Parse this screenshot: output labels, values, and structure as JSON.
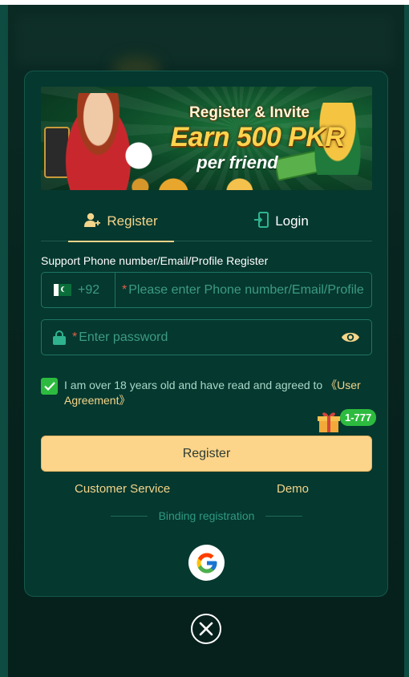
{
  "banner": {
    "line1": "Register & Invite",
    "line2": "Earn 500 PKR",
    "line3": "per friend"
  },
  "tabs": [
    {
      "label": "Register",
      "icon": "user-add-icon",
      "active": true
    },
    {
      "label": "Login",
      "icon": "login-icon",
      "active": false
    }
  ],
  "form": {
    "support_label": "Support Phone number/Email/Profile Register",
    "country_code": "+92",
    "account_required_mark": "*",
    "account_placeholder": "Please enter Phone number/Email/Profile",
    "password_required_mark": "*",
    "password_placeholder": "Enter password",
    "agreement_checked": true,
    "agreement_text": "I am over 18 years old and have read and agreed to ",
    "agreement_link_open": "《User",
    "agreement_link_close": "Agreement》",
    "promo_badge": "1-777",
    "submit_label": "Register"
  },
  "links": {
    "customer_service": "Customer Service",
    "demo": "Demo"
  },
  "binding": {
    "label": "Binding registration",
    "providers": [
      "google"
    ]
  },
  "colors": {
    "accent": "#f4d58a",
    "panel": "#05382f",
    "button": "#fdd58a",
    "check": "#2dbb3f"
  }
}
